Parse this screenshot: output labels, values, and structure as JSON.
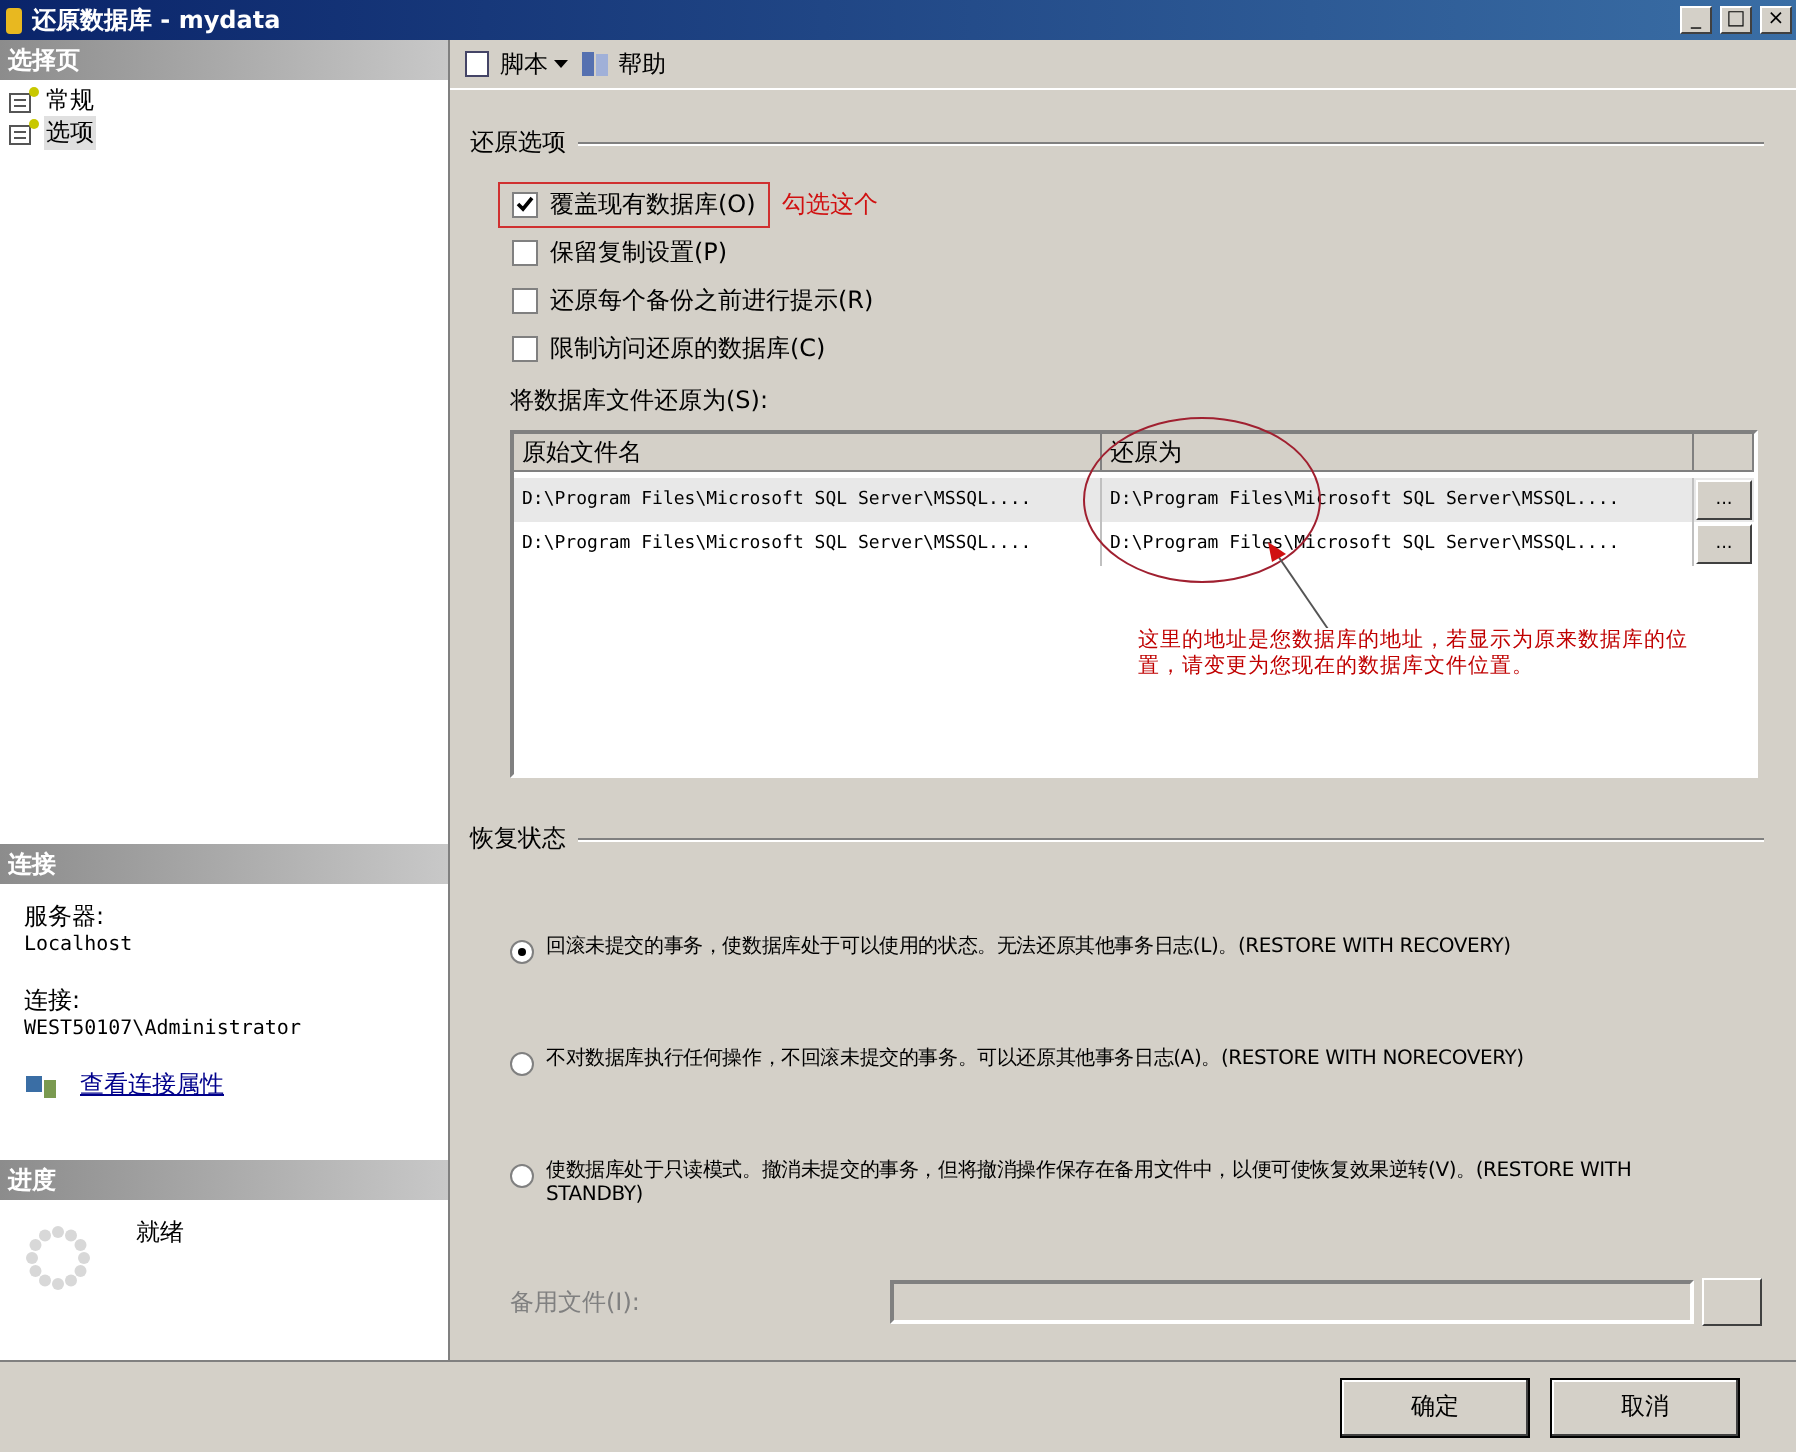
{
  "window": {
    "title": "还原数据库 - mydata",
    "controls": [
      "_",
      "□",
      "×"
    ]
  },
  "sidebar": {
    "header": "选择页",
    "pages": [
      {
        "label": "常规",
        "selected": false
      },
      {
        "label": "选项",
        "selected": true
      }
    ]
  },
  "connection": {
    "header": "连接",
    "server_label": "服务器:",
    "server": "Localhost",
    "connection_label": "连接:",
    "connection": "WEST50107\\Administrator",
    "link": "查看连接属性"
  },
  "progress": {
    "header": "进度",
    "status": "就绪"
  },
  "toolbar": {
    "script": "脚本",
    "help": "帮助"
  },
  "restore_options": {
    "title": "还原选项",
    "options": [
      {
        "label": "覆盖现有数据库(O)",
        "checked": true,
        "highlighted": true
      },
      {
        "label": "保留复制设置(P)",
        "checked": false,
        "highlighted": false
      },
      {
        "label": "还原每个备份之前进行提示(R)",
        "checked": false,
        "highlighted": false
      },
      {
        "label": "限制访问还原的数据库(C)",
        "checked": false,
        "highlighted": false
      }
    ],
    "callout": "勾选这个",
    "files_label": "将数据库文件还原为(S):",
    "table": {
      "columns": [
        "原始文件名",
        "还原为"
      ],
      "rows": [
        {
          "original": "D:\\Program Files\\Microsoft SQL Server\\MSSQL....",
          "restore_as": "D:\\Program Files\\Microsoft SQL Server\\MSSQL....",
          "browse": "...",
          "selected": true
        },
        {
          "original": "D:\\Program Files\\Microsoft SQL Server\\MSSQL....",
          "restore_as": "D:\\Program Files\\Microsoft SQL Server\\MSSQL....",
          "browse": "...",
          "selected": false
        }
      ]
    },
    "note": "这里的地址是您数据库的地址，若显示为原来数据库的位置，请变更为您现在的数据库文件位置。"
  },
  "recovery_state": {
    "title": "恢复状态",
    "options": [
      {
        "label": "回滚未提交的事务，使数据库处于可以使用的状态。无法还原其他事务日志(L)。(RESTORE WITH RECOVERY)",
        "selected": true
      },
      {
        "label": "不对数据库执行任何操作，不回滚未提交的事务。可以还原其他事务日志(A)。(RESTORE WITH NORECOVERY)",
        "selected": false
      },
      {
        "label": "使数据库处于只读模式。撤消未提交的事务，但将撤消操作保存在备用文件中，以便可使恢复效果逆转(V)。(RESTORE WITH STANDBY)",
        "selected": false
      }
    ],
    "standby_label": "备用文件(I):"
  },
  "buttons": {
    "ok": "确定",
    "cancel": "取消"
  }
}
